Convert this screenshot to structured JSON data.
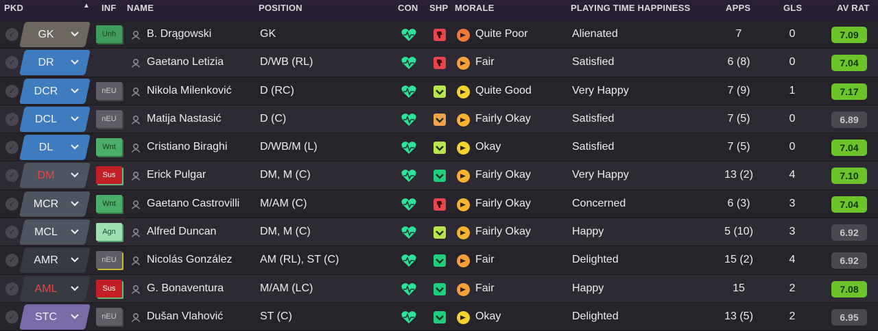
{
  "header": {
    "pkd": "PKD",
    "sort_icon": "▲",
    "inf": "INF",
    "name": "NAME",
    "position": "POSITION",
    "con": "CON",
    "shp": "SHP",
    "morale": "MORALE",
    "playing_time": "PLAYING TIME HAPPINESS",
    "apps": "APPS",
    "gls": "GLS",
    "av_rat": "AV RAT"
  },
  "colors": {
    "rating_high": "#6cc32a",
    "rating_neutral": "#4a4850",
    "condition": "#2de39a",
    "suspension": "#c32026"
  },
  "players": [
    {
      "pkd": "GK",
      "pkd_style": "gk",
      "inf": "Unh",
      "inf_style": "unh",
      "name": "B. Drągowski",
      "position": "GK",
      "shp_icon": "thumb-down-icon",
      "shp_style": "red",
      "morale": "Quite Poor",
      "morale_style": "qp",
      "pth": "Alienated",
      "apps": "7",
      "gls": "0",
      "rating": "7.09",
      "rating_style": "hi"
    },
    {
      "pkd": "DR",
      "pkd_style": "def",
      "inf": "",
      "inf_style": "",
      "name": "Gaetano Letizia",
      "position": "D/WB (RL)",
      "shp_icon": "thumb-down-icon",
      "shp_style": "red",
      "morale": "Fair",
      "morale_style": "fair",
      "pth": "Satisfied",
      "apps": "6 (8)",
      "gls": "0",
      "rating": "7.04",
      "rating_style": "hi"
    },
    {
      "pkd": "DCR",
      "pkd_style": "def",
      "inf": "nEU",
      "inf_style": "neu",
      "name": "Nikola Milenković",
      "position": "D (RC)",
      "shp_icon": "check-icon",
      "shp_style": "lime",
      "morale": "Quite Good",
      "morale_style": "good",
      "pth": "Very Happy",
      "apps": "7 (9)",
      "gls": "1",
      "rating": "7.17",
      "rating_style": "hi"
    },
    {
      "pkd": "DCL",
      "pkd_style": "def",
      "inf": "nEU",
      "inf_style": "neu",
      "name": "Matija Nastasić",
      "position": "D (C)",
      "shp_icon": "check-icon",
      "shp_style": "org",
      "morale": "Fairly Okay",
      "morale_style": "okay",
      "pth": "Satisfied",
      "apps": "7 (5)",
      "gls": "0",
      "rating": "6.89",
      "rating_style": "mid"
    },
    {
      "pkd": "DL",
      "pkd_style": "def",
      "inf": "Wnt",
      "inf_style": "wnt",
      "name": "Cristiano Biraghi",
      "position": "D/WB/M (L)",
      "shp_icon": "check-icon",
      "shp_style": "lime",
      "morale": "Okay",
      "morale_style": "good",
      "pth": "Satisfied",
      "apps": "7 (5)",
      "gls": "0",
      "rating": "7.04",
      "rating_style": "hi"
    },
    {
      "pkd": "DM",
      "pkd_style": "mid",
      "pkd_red": true,
      "inf": "Sus",
      "inf_style": "sus",
      "name": "Erick Pulgar",
      "position": "DM, M (C)",
      "shp_icon": "check-icon",
      "shp_style": "grn",
      "morale": "Fairly Okay",
      "morale_style": "okay",
      "pth": "Very Happy",
      "apps": "13 (2)",
      "gls": "4",
      "rating": "7.10",
      "rating_style": "hi"
    },
    {
      "pkd": "MCR",
      "pkd_style": "mid",
      "inf": "Wnt",
      "inf_style": "wnt",
      "name": "Gaetano Castrovilli",
      "position": "M/AM (C)",
      "shp_icon": "thumb-down-icon",
      "shp_style": "red",
      "morale": "Fairly Okay",
      "morale_style": "okay",
      "pth": "Concerned",
      "apps": "6 (3)",
      "gls": "3",
      "rating": "7.04",
      "rating_style": "hi"
    },
    {
      "pkd": "MCL",
      "pkd_style": "mid",
      "inf": "Agn",
      "inf_style": "agn",
      "name": "Alfred Duncan",
      "position": "DM, M (C)",
      "shp_icon": "check-icon",
      "shp_style": "lime",
      "morale": "Fairly Okay",
      "morale_style": "okay",
      "pth": "Happy",
      "apps": "5 (10)",
      "gls": "3",
      "rating": "6.92",
      "rating_style": "mid"
    },
    {
      "pkd": "AMR",
      "pkd_style": "att",
      "inf": "nEU",
      "inf_style": "neu y",
      "name": "Nicolás González",
      "position": "AM (RL), ST (C)",
      "shp_icon": "check-icon",
      "shp_style": "grn",
      "morale": "Fair",
      "morale_style": "fair",
      "pth": "Delighted",
      "apps": "15 (2)",
      "gls": "4",
      "rating": "6.92",
      "rating_style": "mid"
    },
    {
      "pkd": "AML",
      "pkd_style": "att",
      "pkd_red": true,
      "inf": "Sus",
      "inf_style": "sus",
      "name": "G. Bonaventura",
      "position": "M/AM (LC)",
      "shp_icon": "check-icon",
      "shp_style": "grn",
      "morale": "Fair",
      "morale_style": "fair",
      "pth": "Happy",
      "apps": "15",
      "gls": "2",
      "rating": "7.08",
      "rating_style": "hi"
    },
    {
      "pkd": "STC",
      "pkd_style": "stc",
      "inf": "nEU",
      "inf_style": "neu",
      "name": "Dušan Vlahović",
      "position": "ST (C)",
      "shp_icon": "check-icon",
      "shp_style": "grn",
      "morale": "Okay",
      "morale_style": "good",
      "pth": "Delighted",
      "apps": "13 (5)",
      "gls": "2",
      "rating": "6.95",
      "rating_style": "mid"
    }
  ]
}
